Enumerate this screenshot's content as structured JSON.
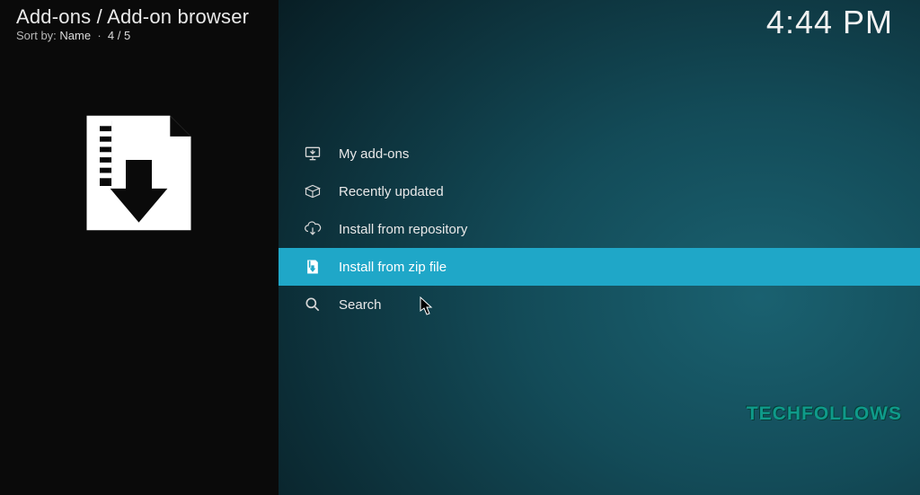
{
  "header": {
    "breadcrumb": "Add-ons / Add-on browser",
    "sort_label": "Sort by:",
    "sort_value": "Name",
    "position": "4 / 5"
  },
  "clock": "4:44 PM",
  "menu": {
    "items": [
      {
        "icon": "monitor-icon",
        "label": "My add-ons"
      },
      {
        "icon": "open-box-icon",
        "label": "Recently updated"
      },
      {
        "icon": "cloud-download-icon",
        "label": "Install from repository"
      },
      {
        "icon": "zip-download-icon",
        "label": "Install from zip file"
      },
      {
        "icon": "search-icon",
        "label": "Search"
      }
    ],
    "highlighted_index": 3
  },
  "watermark": "TECHFOLLOWS"
}
